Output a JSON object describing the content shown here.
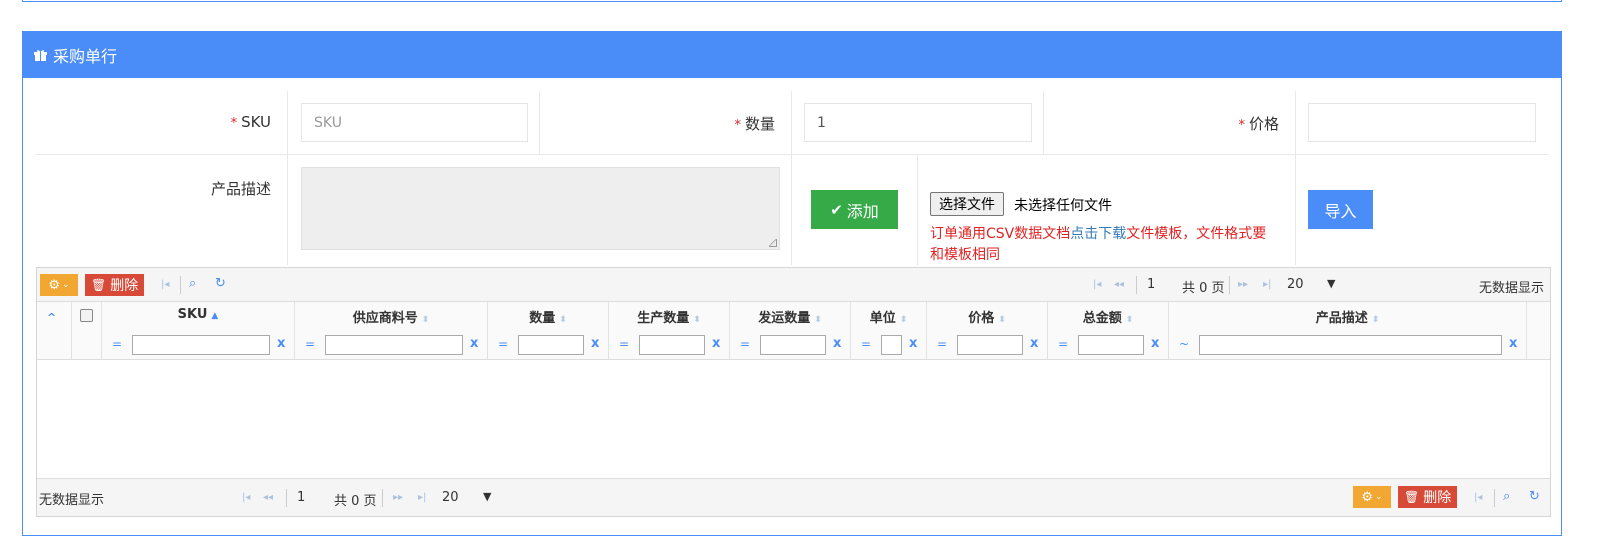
{
  "panel": {
    "title": "采购单行",
    "icon": "gift-icon"
  },
  "form": {
    "sku": {
      "label": "SKU",
      "required": "*",
      "placeholder": "SKU"
    },
    "qty": {
      "label": "数量",
      "required": "*",
      "value": "1"
    },
    "price": {
      "label": "价格",
      "required": "*",
      "value": ""
    },
    "desc": {
      "label": "产品描述"
    },
    "add_button": "添加",
    "file": {
      "button": "选择文件",
      "status": "未选择任何文件"
    },
    "note": {
      "part1": "订单通用CSV数据文档",
      "link": "点击下载",
      "part2": "文件模板，文件格式要和模板相同"
    },
    "import_button": "导入"
  },
  "grid": {
    "toolbar": {
      "delete": "删除"
    },
    "pager": {
      "page": "1",
      "total": "共 0 页",
      "size": "20",
      "size_arrow": "▼",
      "empty": "无数据显示"
    },
    "columns": [
      {
        "label": "SKU",
        "op": "="
      },
      {
        "label": "供应商料号",
        "op": "="
      },
      {
        "label": "数量",
        "op": "="
      },
      {
        "label": "生产数量",
        "op": "="
      },
      {
        "label": "发运数量",
        "op": "="
      },
      {
        "label": "单位",
        "op": "="
      },
      {
        "label": "价格",
        "op": "="
      },
      {
        "label": "总金额",
        "op": "="
      },
      {
        "label": "产品描述",
        "op": "~"
      }
    ],
    "clear_mark": "x",
    "sort_icons": {
      "up": "▲",
      "both": "⬍",
      "collapse": "^"
    },
    "colors": {
      "accent": "#4b8df8",
      "success": "#35aa47",
      "danger": "#d84a38",
      "warning": "#f2a733"
    }
  }
}
